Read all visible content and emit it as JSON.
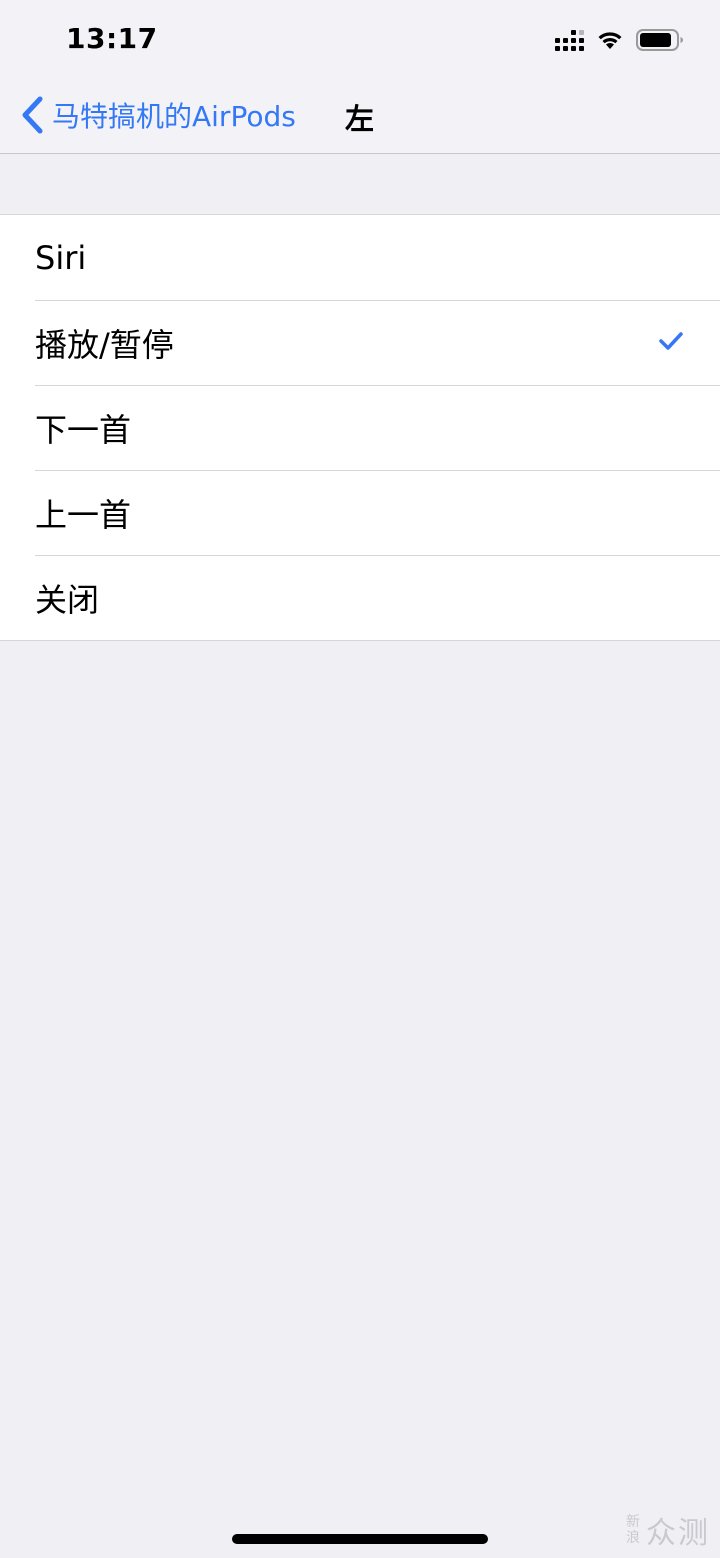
{
  "status_bar": {
    "time": "13:17",
    "icons": [
      "cellular-signal-icon",
      "wifi-icon",
      "battery-icon"
    ]
  },
  "nav": {
    "back_label": "马特搞机的AirPods",
    "title": "左"
  },
  "options": [
    {
      "label": "Siri",
      "selected": false
    },
    {
      "label": "播放/暂停",
      "selected": true
    },
    {
      "label": "下一首",
      "selected": false
    },
    {
      "label": "上一首",
      "selected": false
    },
    {
      "label": "关闭",
      "selected": false
    }
  ],
  "watermark": {
    "line1": "新",
    "line2": "浪",
    "text": "众测"
  },
  "colors": {
    "accent": "#3478f6",
    "background": "#efeff4",
    "bar": "#f2f2f7"
  }
}
